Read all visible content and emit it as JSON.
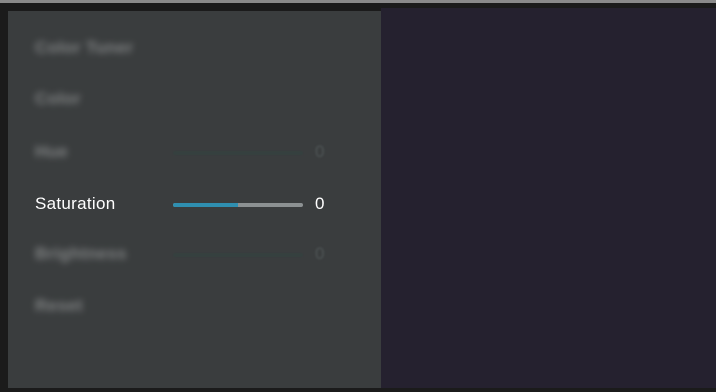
{
  "menu": {
    "items": [
      {
        "id": "color-tuner",
        "label": "Color Tuner",
        "blurred": true
      },
      {
        "id": "color",
        "label": "Color",
        "blurred": true
      },
      {
        "id": "hue",
        "label": "Hue",
        "blurred": true,
        "value": "0",
        "level": 0
      },
      {
        "id": "saturation",
        "label": "Saturation",
        "blurred": false,
        "value": "0",
        "level": 0.5
      },
      {
        "id": "brightness",
        "label": "Brightness",
        "blurred": true,
        "value": "0",
        "level": 0
      },
      {
        "id": "reset",
        "label": "Reset",
        "blurred": true
      }
    ]
  },
  "colors": {
    "panel": "#3a3d3e",
    "preview": "#25212f",
    "accent": "#2f8fb0"
  }
}
